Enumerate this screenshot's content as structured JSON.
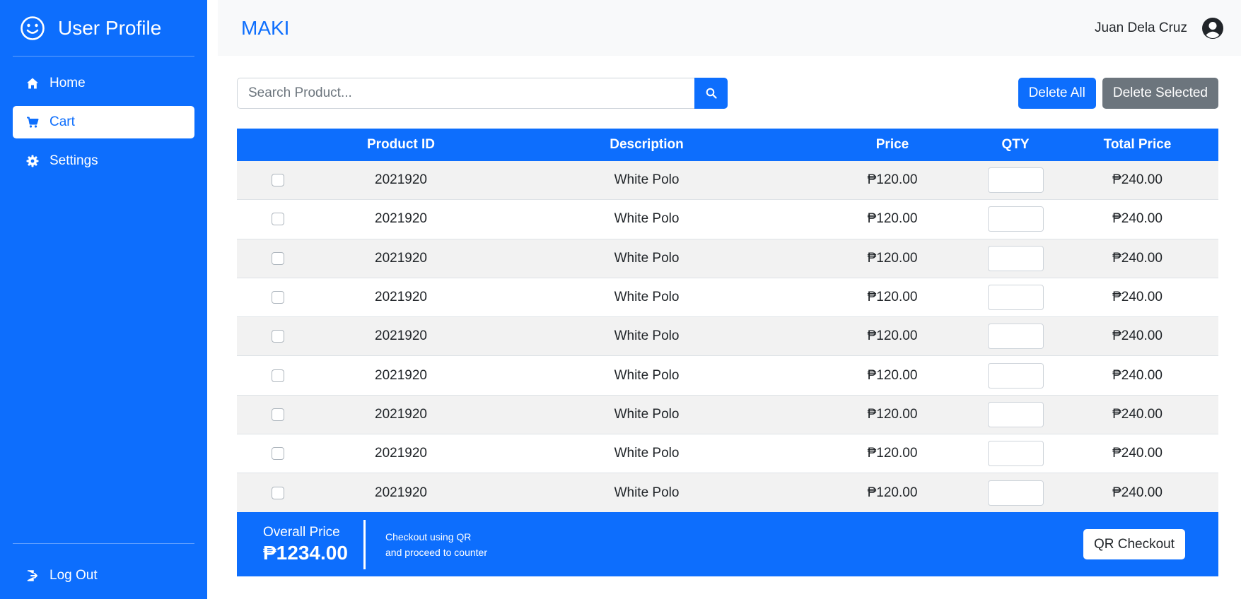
{
  "sidebar": {
    "brand": "User Profile",
    "items": [
      {
        "label": "Home",
        "icon": "home-icon",
        "active": false
      },
      {
        "label": "Cart",
        "icon": "cart-icon",
        "active": true
      },
      {
        "label": "Settings",
        "icon": "gear-icon",
        "active": false
      }
    ],
    "logout_label": "Log Out"
  },
  "header": {
    "brand": "MAKI",
    "user_name": "Juan Dela Cruz"
  },
  "search": {
    "placeholder": "Search Product..."
  },
  "actions": {
    "delete_all": "Delete All",
    "delete_selected": "Delete Selected"
  },
  "table": {
    "columns": [
      "",
      "Product ID",
      "Description",
      "Price",
      "QTY",
      "Total Price"
    ],
    "rows": [
      {
        "product_id": "2021920",
        "description": "White Polo",
        "price": "₱120.00",
        "qty": "",
        "total": "₱240.00"
      },
      {
        "product_id": "2021920",
        "description": "White Polo",
        "price": "₱120.00",
        "qty": "",
        "total": "₱240.00"
      },
      {
        "product_id": "2021920",
        "description": "White Polo",
        "price": "₱120.00",
        "qty": "",
        "total": "₱240.00"
      },
      {
        "product_id": "2021920",
        "description": "White Polo",
        "price": "₱120.00",
        "qty": "",
        "total": "₱240.00"
      },
      {
        "product_id": "2021920",
        "description": "White Polo",
        "price": "₱120.00",
        "qty": "",
        "total": "₱240.00"
      },
      {
        "product_id": "2021920",
        "description": "White Polo",
        "price": "₱120.00",
        "qty": "",
        "total": "₱240.00"
      },
      {
        "product_id": "2021920",
        "description": "White Polo",
        "price": "₱120.00",
        "qty": "",
        "total": "₱240.00"
      },
      {
        "product_id": "2021920",
        "description": "White Polo",
        "price": "₱120.00",
        "qty": "",
        "total": "₱240.00"
      },
      {
        "product_id": "2021920",
        "description": "White Polo",
        "price": "₱120.00",
        "qty": "",
        "total": "₱240.00"
      }
    ]
  },
  "summary": {
    "label": "Overall Price",
    "value": "₱1234.00",
    "note_line1": "Checkout using QR",
    "note_line2": "and proceed to counter",
    "checkout_button": "QR Checkout"
  },
  "colors": {
    "primary": "#0d6efd",
    "secondary": "#6c757d",
    "row_striped": "#f2f2f2",
    "topbar_bg": "#f8f9fa"
  }
}
